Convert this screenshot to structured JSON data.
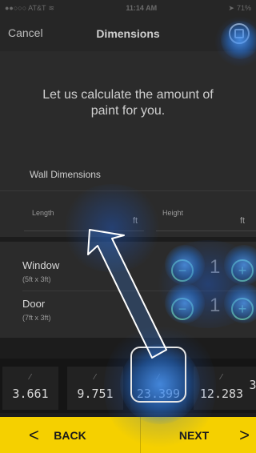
{
  "status_bar": {
    "carrier": "●●○○○ AT&T",
    "time": "11:14 AM",
    "battery": "71%"
  },
  "nav": {
    "cancel_label": "Cancel",
    "title": "Dimensions",
    "right_icon": "calculator-icon"
  },
  "intro": {
    "text": "Let us calculate the amount of paint for you."
  },
  "wall": {
    "title": "Wall Dimensions",
    "length_label": "Length",
    "length_unit": "ft",
    "height_label": "Height",
    "height_unit": "ft"
  },
  "openings": [
    {
      "name": "Window",
      "size": "(5ft x 3ft)",
      "count": "1"
    },
    {
      "name": "Door",
      "size": "(7ft x 3ft)",
      "count": "1"
    }
  ],
  "tiles": [
    {
      "value": "3.661"
    },
    {
      "value": "9.751"
    },
    {
      "value": "23.399"
    },
    {
      "value": "12.283"
    },
    {
      "value": "3"
    }
  ],
  "bottom": {
    "back_label": "BACK",
    "next_label": "NEXT",
    "back_chevron": "<",
    "next_chevron": ">"
  },
  "colors": {
    "accent_yellow": "#f5d000",
    "stepper_green": "#6fbf86",
    "background": "#1c1c1c"
  }
}
